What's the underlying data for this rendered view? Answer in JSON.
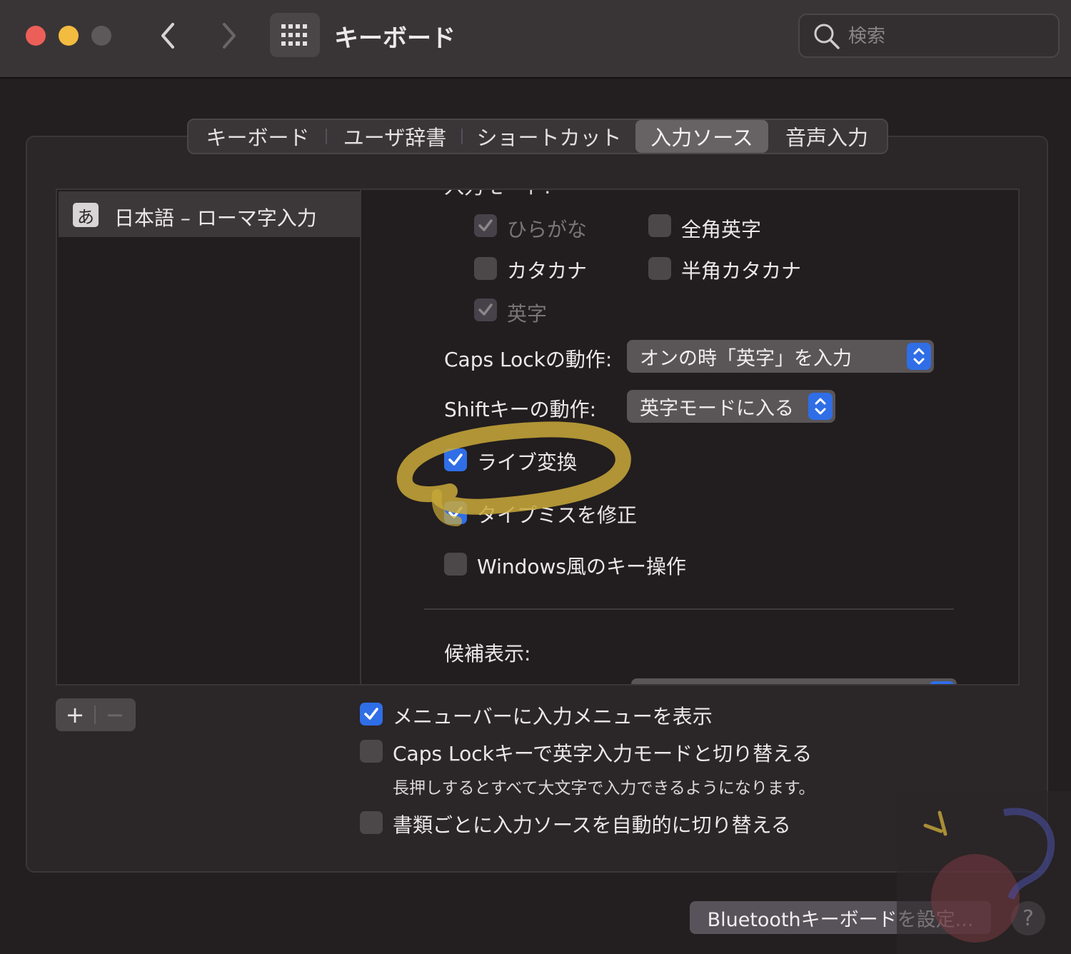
{
  "window": {
    "title": "キーボード",
    "search_placeholder": "検索"
  },
  "tabs": [
    {
      "label": "キーボード",
      "active": false
    },
    {
      "label": "ユーザ辞書",
      "active": false
    },
    {
      "label": "ショートカット",
      "active": false
    },
    {
      "label": "入力ソース",
      "active": true
    },
    {
      "label": "音声入力",
      "active": false
    }
  ],
  "input_sources": [
    {
      "icon_char": "あ",
      "label": "日本語 – ローマ字入力",
      "selected": true
    }
  ],
  "settings": {
    "input_modes_heading": "入力モード:",
    "input_modes": [
      {
        "label": "ひらがな",
        "checked": true,
        "enabled": false
      },
      {
        "label": "全角英字",
        "checked": false,
        "enabled": true
      },
      {
        "label": "カタカナ",
        "checked": false,
        "enabled": true
      },
      {
        "label": "半角カタカナ",
        "checked": false,
        "enabled": true
      },
      {
        "label": "英字",
        "checked": true,
        "enabled": false
      }
    ],
    "caps_lock_label": "Caps Lockの動作:",
    "caps_lock_value": "オンの時「英字」を入力",
    "shift_label": "Shiftキーの動作:",
    "shift_value": "英字モードに入る",
    "options": [
      {
        "label": "ライブ変換",
        "checked": true
      },
      {
        "label": "タイプミスを修正",
        "checked": true
      },
      {
        "label": "Windows風のキー操作",
        "checked": false
      }
    ],
    "candidates_label": "候補表示:"
  },
  "list_controls": {
    "add": "+",
    "remove": "−"
  },
  "general_options": [
    {
      "label": "メニューバーに入力メニューを表示",
      "checked": true
    },
    {
      "label": "Caps Lockキーで英字入力モードと切り替える",
      "checked": false
    },
    {
      "label": "書類ごとに入力ソースを自動的に切り替える",
      "checked": false
    }
  ],
  "caps_lock_note": "長押しするとすべて大文字で入力できるようになります。",
  "bluetooth_button": "Bluetoothキーボードを設定...",
  "help_button": "?",
  "colors": {
    "accent": "#2f6ee6",
    "annotation": "#c9a93a",
    "close": "#ec5f58",
    "minimize": "#f3bb3f"
  }
}
